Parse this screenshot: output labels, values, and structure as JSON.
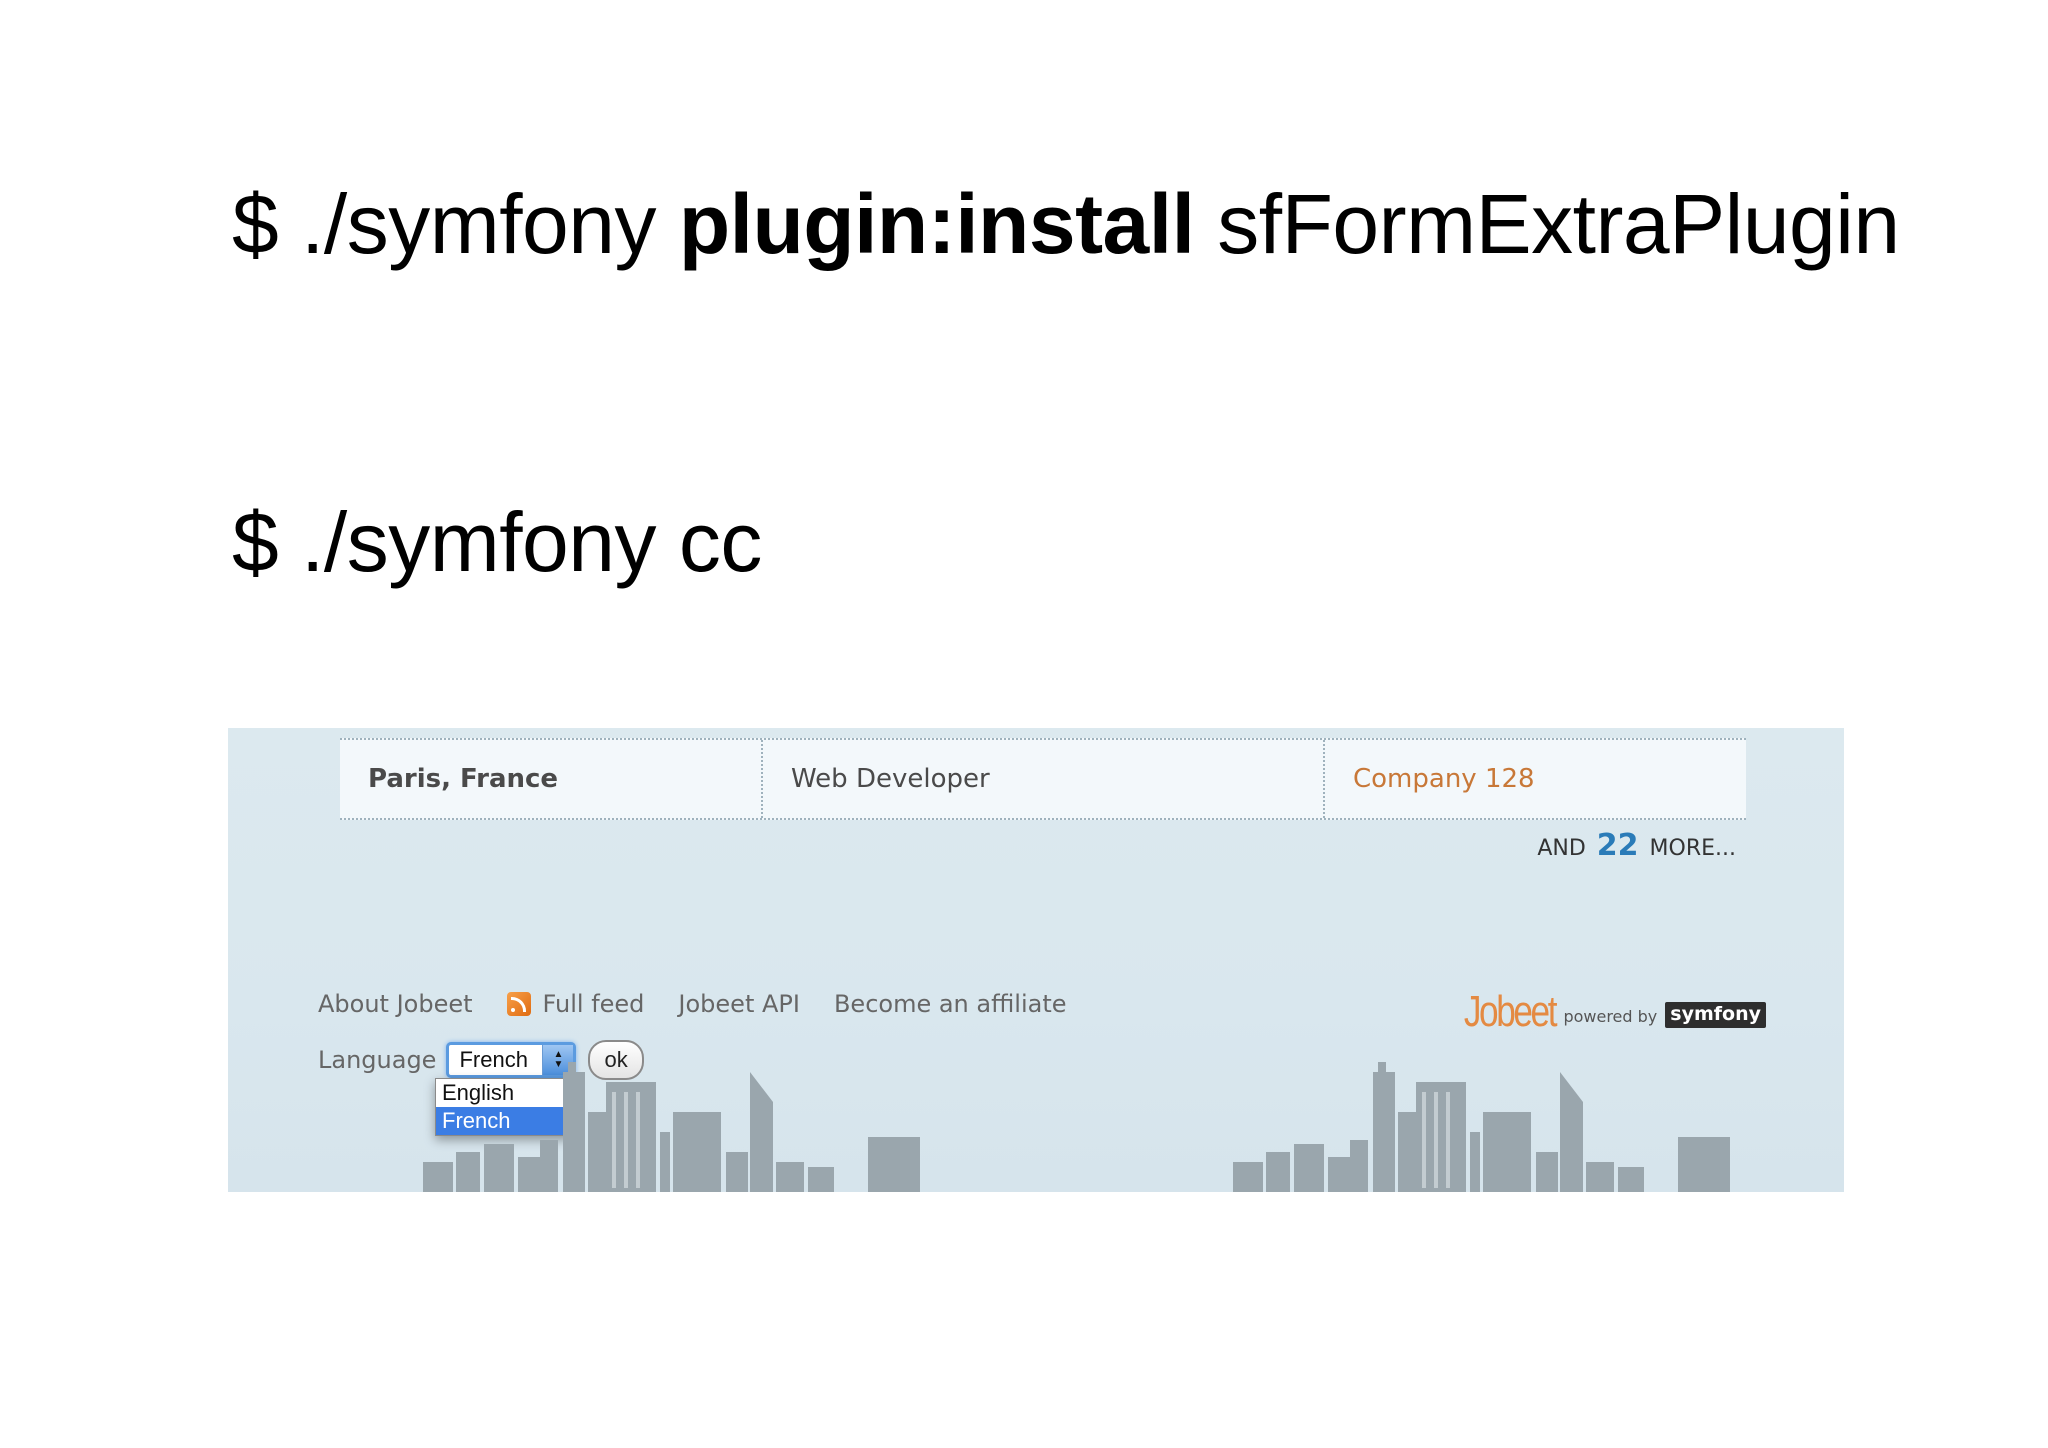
{
  "slide": {
    "command1": {
      "prefix": "$ ./symfony ",
      "task": "plugin:install",
      "argument": " sfFormExtraPlugin"
    },
    "command2": "$ ./symfony cc"
  },
  "jobeet": {
    "job_row": {
      "location": "Paris, France",
      "position": "Web Developer",
      "company": "Company 128"
    },
    "more": {
      "prefix": "and",
      "count": "22",
      "suffix": "more..."
    },
    "footer": {
      "links": {
        "about": "About Jobeet",
        "feed": "Full feed",
        "api": "Jobeet API",
        "affiliate": "Become an affiliate"
      },
      "language_label": "Language",
      "language_selected": "French",
      "language_options": [
        "English",
        "French"
      ],
      "ok_label": "ok"
    },
    "brand": {
      "logo": "Jobeet",
      "powered_by": "powered by",
      "framework": "symfony"
    },
    "colors": {
      "background": "#dae8ef",
      "company_link": "#c87838",
      "more_count": "#2a7bb8",
      "logo": "#e48a42",
      "selected_option": "#3b7de4"
    }
  }
}
